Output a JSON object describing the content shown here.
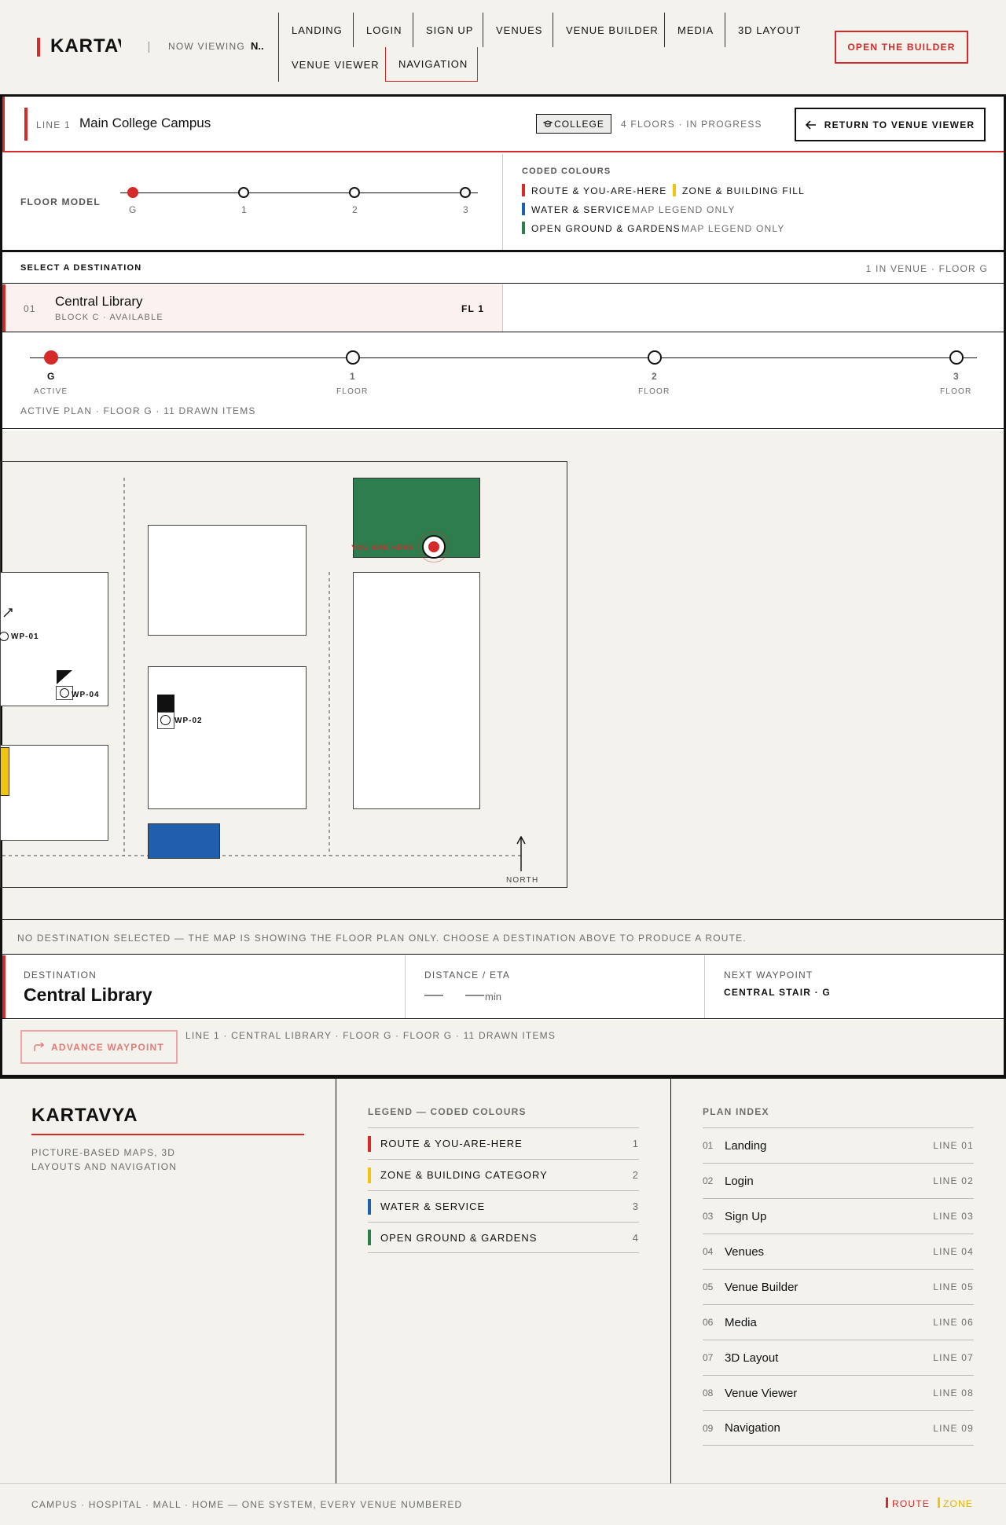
{
  "header": {
    "logo": "KARTAVYA",
    "now_viewing_label": "NOW VIEWING",
    "now_viewing_value": "N..",
    "nav": [
      "LANDING",
      "LOGIN",
      "SIGN UP",
      "VENUES",
      "VENUE BUILDER",
      "MEDIA",
      "3D LAYOUT",
      "VENUE VIEWER",
      "NAVIGATION"
    ],
    "builder_button": "OPEN THE BUILDER"
  },
  "venue": {
    "line_label": "LINE 1",
    "name": "Main College Campus",
    "category": "COLLEGE",
    "meta": "4 FLOORS · IN PROGRESS",
    "return_button": "RETURN TO VENUE VIEWER"
  },
  "floor_model": {
    "label": "FLOOR MODEL",
    "floors": [
      "G",
      "1",
      "2",
      "3"
    ],
    "active_index": 0
  },
  "coded_colours": {
    "title": "CODED COLOURS",
    "items": [
      {
        "label": "ROUTE & YOU-ARE-HERE",
        "note": "",
        "color": "#d42a2a"
      },
      {
        "label": "ZONE & BUILDING FILL",
        "note": "",
        "color": "#f1c40f"
      },
      {
        "label": "WATER & SERVICE",
        "note": "MAP LEGEND ONLY",
        "color": "#1f5fae"
      },
      {
        "label": "OPEN GROUND & GARDENS",
        "note": "MAP LEGEND ONLY",
        "color": "#2e7d4f"
      }
    ]
  },
  "destinations": {
    "title": "SELECT A DESTINATION",
    "summary": "1 IN VENUE · FLOOR G",
    "items": [
      {
        "num": "01",
        "name": "Central Library",
        "sub": "BLOCK C · AVAILABLE",
        "floor": "FL 1"
      }
    ]
  },
  "floor_track": {
    "floors": [
      {
        "label": "G",
        "sub": "ACTIVE"
      },
      {
        "label": "1",
        "sub": "FLOOR"
      },
      {
        "label": "2",
        "sub": "FLOOR"
      },
      {
        "label": "3",
        "sub": "FLOOR"
      }
    ],
    "active_index": 0,
    "plan_info": "ACTIVE PLAN · FLOOR G · 11 DRAWN ITEMS"
  },
  "map": {
    "you_are_here": "YOU ARE HERE",
    "waypoints": [
      "WP-01",
      "WP-04",
      "WP-02"
    ],
    "north": "NORTH"
  },
  "status_message": "NO DESTINATION SELECTED — THE MAP IS SHOWING THE FLOOR PLAN ONLY. CHOOSE A DESTINATION ABOVE TO PRODUCE A ROUTE.",
  "route_panel": {
    "destination_label": "DESTINATION",
    "destination_value": "Central Library",
    "distance_label": "DISTANCE / ETA",
    "distance_unit": "min",
    "next_label": "NEXT WAYPOINT",
    "next_value": "CENTRAL STAIR · G"
  },
  "advance": {
    "button": "ADVANCE WAYPOINT",
    "info": "LINE 1 · CENTRAL LIBRARY · FLOOR G · FLOOR G · 11 DRAWN ITEMS"
  },
  "footer": {
    "brand": "KARTAVYA",
    "tagline_1": "PICTURE-BASED MAPS, 3D",
    "tagline_2": "LAYOUTS AND NAVIGATION",
    "legend_title": "LEGEND — CODED COLOURS",
    "legend": [
      {
        "label": "ROUTE & YOU-ARE-HERE",
        "n": "1",
        "color": "#d42a2a"
      },
      {
        "label": "ZONE & BUILDING CATEGORY",
        "n": "2",
        "color": "#f1c40f"
      },
      {
        "label": "WATER & SERVICE",
        "n": "3",
        "color": "#1f5fae"
      },
      {
        "label": "OPEN GROUND & GARDENS",
        "n": "4",
        "color": "#2e7d4f"
      }
    ],
    "index_title": "PLAN INDEX",
    "index": [
      {
        "n": "01",
        "name": "Landing",
        "line": "LINE 01"
      },
      {
        "n": "02",
        "name": "Login",
        "line": "LINE 02"
      },
      {
        "n": "03",
        "name": "Sign Up",
        "line": "LINE 03"
      },
      {
        "n": "04",
        "name": "Venues",
        "line": "LINE 04"
      },
      {
        "n": "05",
        "name": "Venue Builder",
        "line": "LINE 05"
      },
      {
        "n": "06",
        "name": "Media",
        "line": "LINE 06"
      },
      {
        "n": "07",
        "name": "3D Layout",
        "line": "LINE 07"
      },
      {
        "n": "08",
        "name": "Venue Viewer",
        "line": "LINE 08"
      },
      {
        "n": "09",
        "name": "Navigation",
        "line": "LINE 09"
      }
    ],
    "bottom_text": "CAMPUS · HOSPITAL · MALL · HOME — ONE SYSTEM, EVERY VENUE NUMBERED",
    "bottom_route": "ROUTE",
    "bottom_zone": "ZONE"
  }
}
